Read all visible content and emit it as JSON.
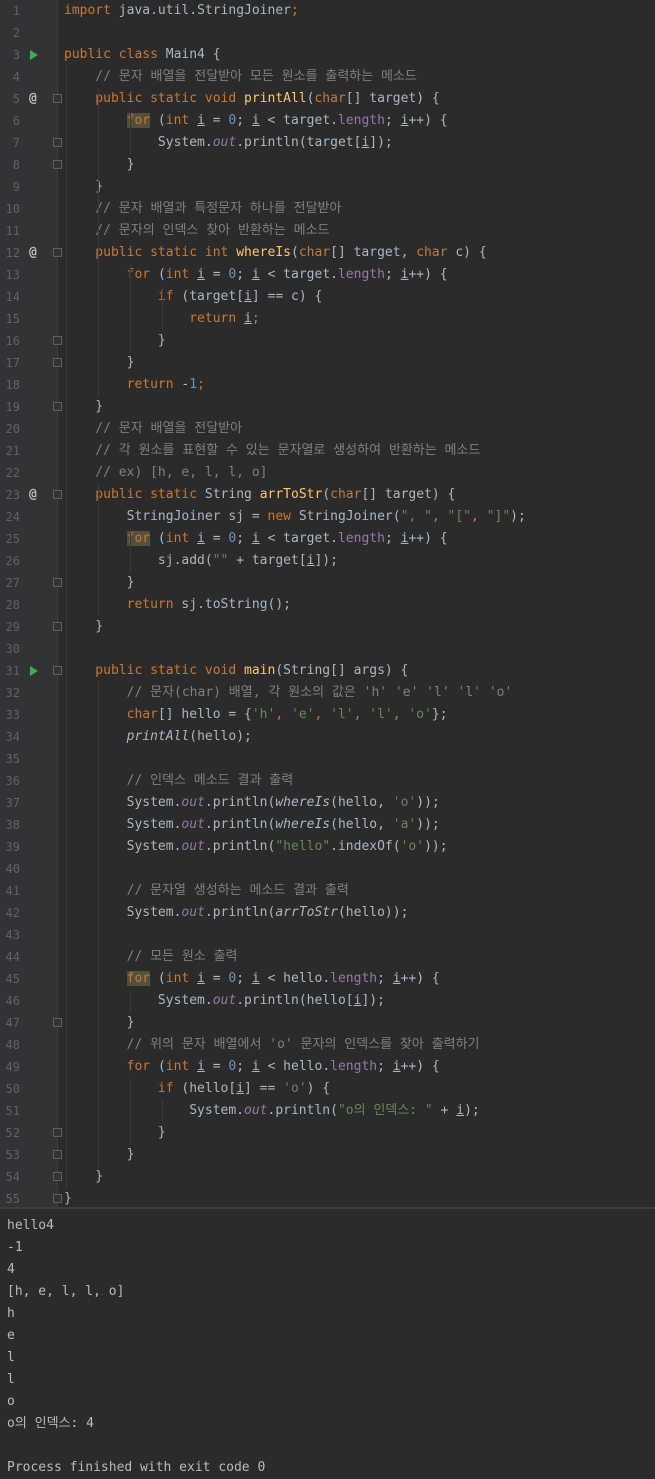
{
  "editor": {
    "lines": [
      [
        {
          "t": "import ",
          "c": "k"
        },
        {
          "t": "java.util.StringJoiner"
        },
        {
          "t": ";",
          "c": "k"
        }
      ],
      [],
      [
        {
          "t": "public class ",
          "c": "k"
        },
        {
          "t": "Main4 {"
        }
      ],
      [
        {
          "t": "    // 문자 배열을 전달받아 모든 원소를 출력하는 메소드",
          "c": "c"
        }
      ],
      [
        {
          "t": "    public static void ",
          "c": "k"
        },
        {
          "t": "printAll",
          "c": "fn"
        },
        {
          "t": "("
        },
        {
          "t": "char",
          "c": "k"
        },
        {
          "t": "[] target) {"
        }
      ],
      [
        {
          "t": "        "
        },
        {
          "t": "for",
          "c": "k hl"
        },
        {
          "t": " ("
        },
        {
          "t": "int ",
          "c": "k"
        },
        {
          "t": "i",
          "c": "u"
        },
        {
          "t": " = "
        },
        {
          "t": "0",
          "c": "n"
        },
        {
          "t": "; "
        },
        {
          "t": "i",
          "c": "u"
        },
        {
          "t": " < target."
        },
        {
          "t": "length",
          "c": "f"
        },
        {
          "t": "; "
        },
        {
          "t": "i",
          "c": "u"
        },
        {
          "t": "++) {"
        }
      ],
      [
        {
          "t": "            System."
        },
        {
          "t": "out",
          "c": "f i"
        },
        {
          "t": ".println(target["
        },
        {
          "t": "i",
          "c": "u"
        },
        {
          "t": "]);"
        }
      ],
      [
        {
          "t": "        }"
        }
      ],
      [
        {
          "t": "    }"
        }
      ],
      [
        {
          "t": "    // 문자 배열과 특정문자 하나를 전달받아",
          "c": "c"
        }
      ],
      [
        {
          "t": "    // 문자의 인덱스 찾아 반환하는 메소드",
          "c": "c"
        }
      ],
      [
        {
          "t": "    public static int ",
          "c": "k"
        },
        {
          "t": "whereIs",
          "c": "fn"
        },
        {
          "t": "("
        },
        {
          "t": "char",
          "c": "k"
        },
        {
          "t": "[] target, "
        },
        {
          "t": "char ",
          "c": "k"
        },
        {
          "t": "c) {"
        }
      ],
      [
        {
          "t": "        "
        },
        {
          "t": "for ",
          "c": "k"
        },
        {
          "t": "("
        },
        {
          "t": "int ",
          "c": "k"
        },
        {
          "t": "i",
          "c": "u"
        },
        {
          "t": " = "
        },
        {
          "t": "0",
          "c": "n"
        },
        {
          "t": "; "
        },
        {
          "t": "i",
          "c": "u"
        },
        {
          "t": " < target."
        },
        {
          "t": "length",
          "c": "f"
        },
        {
          "t": "; "
        },
        {
          "t": "i",
          "c": "u"
        },
        {
          "t": "++) {"
        }
      ],
      [
        {
          "t": "            "
        },
        {
          "t": "if ",
          "c": "k"
        },
        {
          "t": "(target["
        },
        {
          "t": "i",
          "c": "u"
        },
        {
          "t": "] == c) {"
        }
      ],
      [
        {
          "t": "                "
        },
        {
          "t": "return ",
          "c": "k"
        },
        {
          "t": "i",
          "c": "u"
        },
        {
          "t": ";",
          "c": "k"
        }
      ],
      [
        {
          "t": "            }"
        }
      ],
      [
        {
          "t": "        }"
        }
      ],
      [
        {
          "t": "        "
        },
        {
          "t": "return ",
          "c": "k"
        },
        {
          "t": "-"
        },
        {
          "t": "1",
          "c": "n"
        },
        {
          "t": ";",
          "c": "k"
        }
      ],
      [
        {
          "t": "    }"
        }
      ],
      [
        {
          "t": "    // 문자 배열을 전달받아",
          "c": "c"
        }
      ],
      [
        {
          "t": "    // 각 원소를 표현할 수 있는 문자열로 생성하여 반환하는 메소드",
          "c": "c"
        }
      ],
      [
        {
          "t": "    // ex) [h, e, l, l, o]",
          "c": "c"
        }
      ],
      [
        {
          "t": "    public static ",
          "c": "k"
        },
        {
          "t": "String "
        },
        {
          "t": "arrToStr",
          "c": "fn"
        },
        {
          "t": "("
        },
        {
          "t": "char",
          "c": "k"
        },
        {
          "t": "[] target) {"
        }
      ],
      [
        {
          "t": "        StringJoiner sj = "
        },
        {
          "t": "new ",
          "c": "k"
        },
        {
          "t": "StringJoiner("
        },
        {
          "t": "\", \"",
          "c": "s"
        },
        {
          "t": ", ",
          "c": "k"
        },
        {
          "t": "\"[\"",
          "c": "s"
        },
        {
          "t": ", ",
          "c": "k"
        },
        {
          "t": "\"]\"",
          "c": "s"
        },
        {
          "t": ");"
        }
      ],
      [
        {
          "t": "        "
        },
        {
          "t": "for",
          "c": "k hl"
        },
        {
          "t": " ("
        },
        {
          "t": "int ",
          "c": "k"
        },
        {
          "t": "i",
          "c": "u"
        },
        {
          "t": " = "
        },
        {
          "t": "0",
          "c": "n"
        },
        {
          "t": "; "
        },
        {
          "t": "i",
          "c": "u"
        },
        {
          "t": " < target."
        },
        {
          "t": "length",
          "c": "f"
        },
        {
          "t": "; "
        },
        {
          "t": "i",
          "c": "u"
        },
        {
          "t": "++) {"
        }
      ],
      [
        {
          "t": "            sj.add("
        },
        {
          "t": "\"\"",
          "c": "s"
        },
        {
          "t": " + target["
        },
        {
          "t": "i",
          "c": "u"
        },
        {
          "t": "]);"
        }
      ],
      [
        {
          "t": "        }"
        }
      ],
      [
        {
          "t": "        "
        },
        {
          "t": "return ",
          "c": "k"
        },
        {
          "t": "sj.toString();"
        }
      ],
      [
        {
          "t": "    }"
        }
      ],
      [],
      [
        {
          "t": "    public static void ",
          "c": "k"
        },
        {
          "t": "main",
          "c": "fn"
        },
        {
          "t": "(String[] args) {"
        }
      ],
      [
        {
          "t": "        // 문자(char) 배열, 각 원소의 값은 'h' 'e' 'l' 'l' 'o'",
          "c": "c"
        }
      ],
      [
        {
          "t": "        "
        },
        {
          "t": "char",
          "c": "k"
        },
        {
          "t": "[] hello = {"
        },
        {
          "t": "'h'",
          "c": "s"
        },
        {
          "t": ", ",
          "c": "k"
        },
        {
          "t": "'e'",
          "c": "s"
        },
        {
          "t": ", ",
          "c": "k"
        },
        {
          "t": "'l'",
          "c": "s"
        },
        {
          "t": ", ",
          "c": "k"
        },
        {
          "t": "'l'",
          "c": "s"
        },
        {
          "t": ", ",
          "c": "k"
        },
        {
          "t": "'o'",
          "c": "s"
        },
        {
          "t": "};"
        }
      ],
      [
        {
          "t": "        "
        },
        {
          "t": "printAll",
          "c": "i"
        },
        {
          "t": "(hello);"
        }
      ],
      [],
      [
        {
          "t": "        // 인덱스 메소드 결과 출력",
          "c": "c"
        }
      ],
      [
        {
          "t": "        System."
        },
        {
          "t": "out",
          "c": "f i"
        },
        {
          "t": ".println("
        },
        {
          "t": "whereIs",
          "c": "i"
        },
        {
          "t": "(hello, "
        },
        {
          "t": "'o'",
          "c": "s"
        },
        {
          "t": "));"
        }
      ],
      [
        {
          "t": "        System."
        },
        {
          "t": "out",
          "c": "f i"
        },
        {
          "t": ".println("
        },
        {
          "t": "whereIs",
          "c": "i"
        },
        {
          "t": "(hello, "
        },
        {
          "t": "'a'",
          "c": "s"
        },
        {
          "t": "));"
        }
      ],
      [
        {
          "t": "        System."
        },
        {
          "t": "out",
          "c": "f i"
        },
        {
          "t": ".println("
        },
        {
          "t": "\"hello\"",
          "c": "s"
        },
        {
          "t": ".indexOf("
        },
        {
          "t": "'o'",
          "c": "s"
        },
        {
          "t": "));"
        }
      ],
      [],
      [
        {
          "t": "        // 문자열 생성하는 메소드 결과 출력",
          "c": "c"
        }
      ],
      [
        {
          "t": "        System."
        },
        {
          "t": "out",
          "c": "f i"
        },
        {
          "t": ".println("
        },
        {
          "t": "arrToStr",
          "c": "i"
        },
        {
          "t": "(hello));"
        }
      ],
      [],
      [
        {
          "t": "        // 모든 원소 출력",
          "c": "c"
        }
      ],
      [
        {
          "t": "        "
        },
        {
          "t": "for",
          "c": "k hl"
        },
        {
          "t": " ("
        },
        {
          "t": "int ",
          "c": "k"
        },
        {
          "t": "i",
          "c": "u"
        },
        {
          "t": " = "
        },
        {
          "t": "0",
          "c": "n"
        },
        {
          "t": "; "
        },
        {
          "t": "i",
          "c": "u"
        },
        {
          "t": " < hello."
        },
        {
          "t": "length",
          "c": "f"
        },
        {
          "t": "; "
        },
        {
          "t": "i",
          "c": "u"
        },
        {
          "t": "++) {"
        }
      ],
      [
        {
          "t": "            System."
        },
        {
          "t": "out",
          "c": "f i"
        },
        {
          "t": ".println(hello["
        },
        {
          "t": "i",
          "c": "u"
        },
        {
          "t": "]);"
        }
      ],
      [
        {
          "t": "        }"
        }
      ],
      [
        {
          "t": "        // 위의 문자 배열에서 'o' 문자의 인덱스를 찾아 출력하기",
          "c": "c"
        }
      ],
      [
        {
          "t": "        "
        },
        {
          "t": "for ",
          "c": "k"
        },
        {
          "t": "("
        },
        {
          "t": "int ",
          "c": "k"
        },
        {
          "t": "i",
          "c": "u"
        },
        {
          "t": " = "
        },
        {
          "t": "0",
          "c": "n"
        },
        {
          "t": "; "
        },
        {
          "t": "i",
          "c": "u"
        },
        {
          "t": " < hello."
        },
        {
          "t": "length",
          "c": "f"
        },
        {
          "t": "; "
        },
        {
          "t": "i",
          "c": "u"
        },
        {
          "t": "++) {"
        }
      ],
      [
        {
          "t": "            "
        },
        {
          "t": "if ",
          "c": "k"
        },
        {
          "t": "(hello["
        },
        {
          "t": "i",
          "c": "u"
        },
        {
          "t": "] == "
        },
        {
          "t": "'o'",
          "c": "s"
        },
        {
          "t": ") {"
        }
      ],
      [
        {
          "t": "                System."
        },
        {
          "t": "out",
          "c": "f i"
        },
        {
          "t": ".println("
        },
        {
          "t": "\"o의 인덱스: \"",
          "c": "s"
        },
        {
          "t": " + "
        },
        {
          "t": "i",
          "c": "u"
        },
        {
          "t": ");"
        }
      ],
      [
        {
          "t": "            }"
        }
      ],
      [
        {
          "t": "        }"
        }
      ],
      [
        {
          "t": "    }"
        }
      ],
      [
        {
          "t": "}"
        }
      ]
    ],
    "run_lines": [
      3,
      31
    ],
    "override_lines": [
      5,
      12,
      23
    ],
    "override_symbol": "@",
    "fold_lines": [
      5,
      7,
      8,
      12,
      16,
      17,
      19,
      23,
      27,
      29,
      31,
      47,
      52,
      53,
      54,
      55
    ]
  },
  "console": {
    "lines": [
      "hello4",
      "-1",
      "4",
      "[h, e, l, l, o]",
      "h",
      "e",
      "l",
      "l",
      "o",
      "o의 인덱스: 4",
      "",
      "Process finished with exit code 0"
    ]
  }
}
